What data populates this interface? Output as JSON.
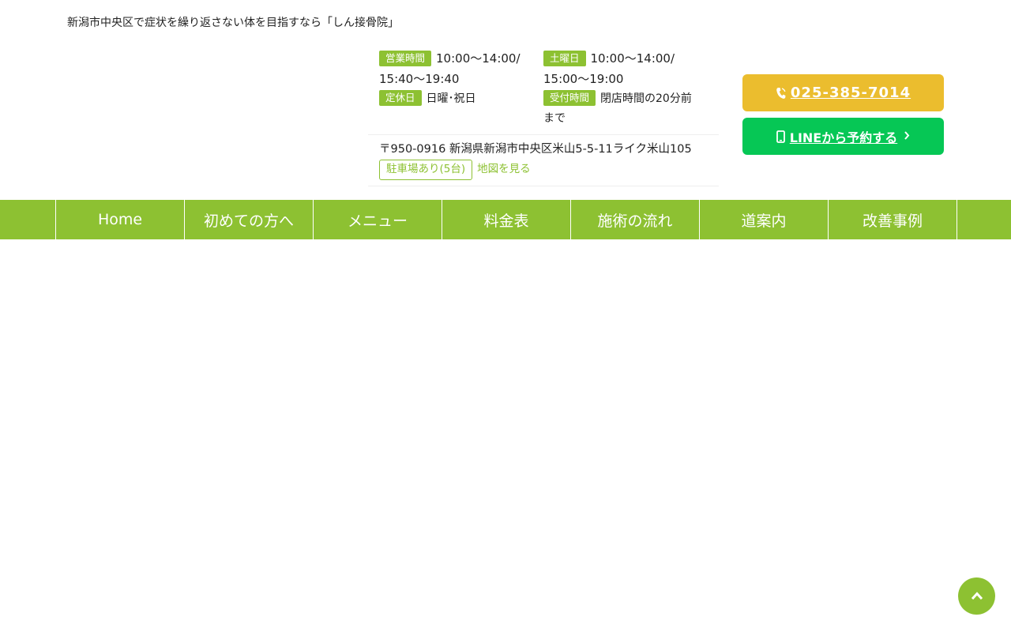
{
  "header": {
    "tagline": "新潟市中央区で症状を繰り返さない体を目指すなら「しん接骨院」"
  },
  "hours": {
    "weekday_label": "営業時間",
    "weekday_line1": "10:00〜14:00/",
    "weekday_line2": "15:40〜19:40",
    "saturday_label": "土曜日",
    "saturday_line1": "10:00〜14:00/",
    "saturday_line2": "15:00〜19:00",
    "closed_label": "定休日",
    "closed_value": "日曜･祝日",
    "reception_label": "受付時間",
    "reception_line1": "閉店時間の20分前",
    "reception_line2": "まで"
  },
  "address": {
    "text": "〒950-0916 新潟県新潟市中央区米山5-5-11ライク米山105",
    "parking": "駐車場あり(5台)",
    "map_link": "地図を見る"
  },
  "cta": {
    "phone": "025-385-7014",
    "line": "LINEから予約する"
  },
  "nav": {
    "items": [
      "Home",
      "初めての方へ",
      "メニュー",
      "料金表",
      "施術の流れ",
      "道案内",
      "改善事例"
    ]
  },
  "colors": {
    "accent_green": "#8dc132",
    "phone_yellow": "#ebbd2e",
    "line_green": "#06c755"
  },
  "icons": {
    "phone": "phone-icon",
    "line": "smartphone-icon",
    "chevron": "chevron-right-icon",
    "to_top": "chevron-up-icon"
  }
}
